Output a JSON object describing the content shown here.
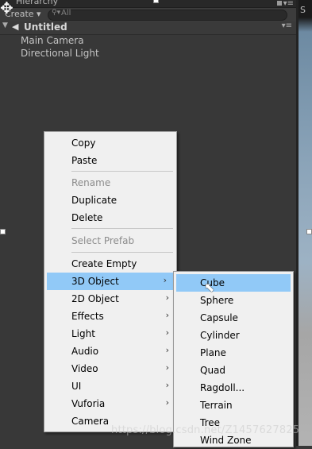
{
  "hierarchy": {
    "tab_label": "Hierarchy",
    "create_label": "Create ▾",
    "search_placeholder": "All",
    "scene_name": "Untitled",
    "items": [
      "Main Camera",
      "Directional Light"
    ]
  },
  "sceneview": {
    "letter": "S"
  },
  "context_menu": {
    "items": [
      {
        "label": "Copy",
        "enabled": true
      },
      {
        "label": "Paste",
        "enabled": true
      },
      {
        "label": "Rename",
        "enabled": false
      },
      {
        "label": "Duplicate",
        "enabled": true
      },
      {
        "label": "Delete",
        "enabled": true
      },
      {
        "label": "Select Prefab",
        "enabled": false
      },
      {
        "label": "Create Empty",
        "enabled": true
      },
      {
        "label": "3D Object",
        "enabled": true,
        "submenu": true,
        "highlighted": true
      },
      {
        "label": "2D Object",
        "enabled": true,
        "submenu": true
      },
      {
        "label": "Effects",
        "enabled": true,
        "submenu": true
      },
      {
        "label": "Light",
        "enabled": true,
        "submenu": true
      },
      {
        "label": "Audio",
        "enabled": true,
        "submenu": true
      },
      {
        "label": "Video",
        "enabled": true,
        "submenu": true
      },
      {
        "label": "UI",
        "enabled": true,
        "submenu": true
      },
      {
        "label": "Vuforia",
        "enabled": true,
        "submenu": true
      },
      {
        "label": "Camera",
        "enabled": true
      }
    ]
  },
  "submenu_3d": {
    "items": [
      "Cube",
      "Sphere",
      "Capsule",
      "Cylinder",
      "Plane",
      "Quad",
      "Ragdoll...",
      "Terrain",
      "Tree",
      "Wind Zone"
    ],
    "highlighted": "Cube"
  },
  "watermark": "https://blog.csdn.net/Z1457627825",
  "colors": {
    "panel_bg": "#383838",
    "menu_bg": "#f0f0f0",
    "highlight": "#91c9f7"
  }
}
